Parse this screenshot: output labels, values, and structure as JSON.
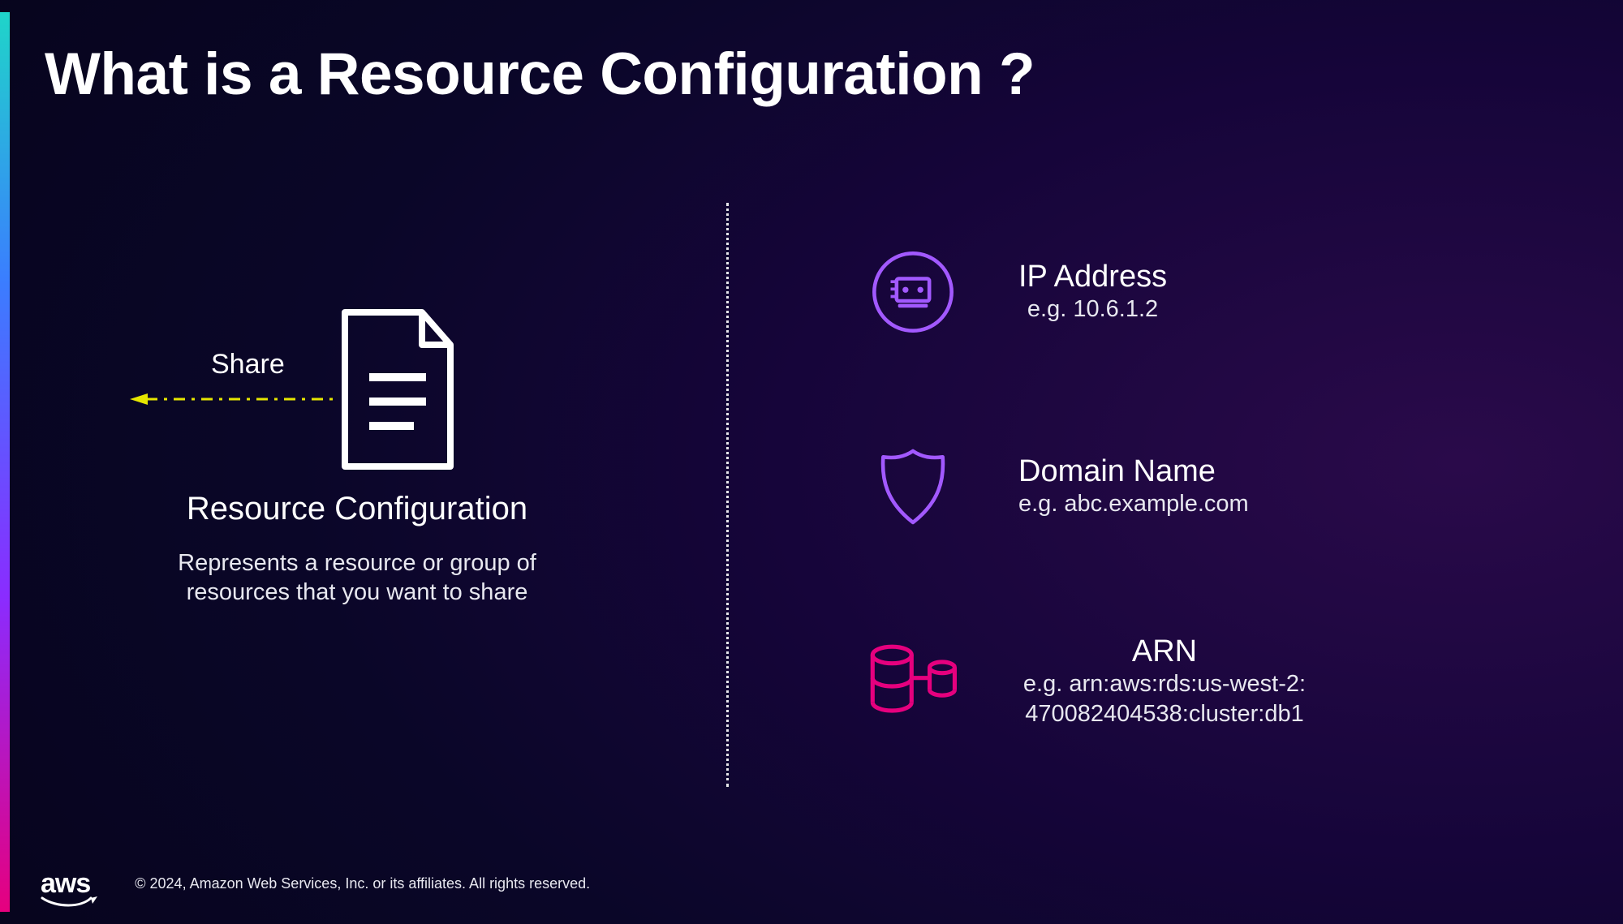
{
  "title": "What is a Resource Configuration ?",
  "left": {
    "share_label": "Share",
    "heading": "Resource Configuration",
    "description": "Represents a resource or group of resources that you want to share"
  },
  "right": {
    "items": [
      {
        "title": "IP Address",
        "subtitle": "e.g. 10.6.1.2"
      },
      {
        "title": "Domain Name",
        "subtitle": "e.g. abc.example.com"
      },
      {
        "title": "ARN",
        "subtitle": "e.g. arn:aws:rds:us-west-2: 470082404538:cluster:db1"
      }
    ]
  },
  "footer": {
    "logo": "aws",
    "copyright": "© 2024, Amazon Web Services, Inc. or its affiliates. All rights reserved."
  },
  "colors": {
    "purple": "#a259ff",
    "magenta": "#e6007e",
    "yellow": "#e6e600"
  }
}
